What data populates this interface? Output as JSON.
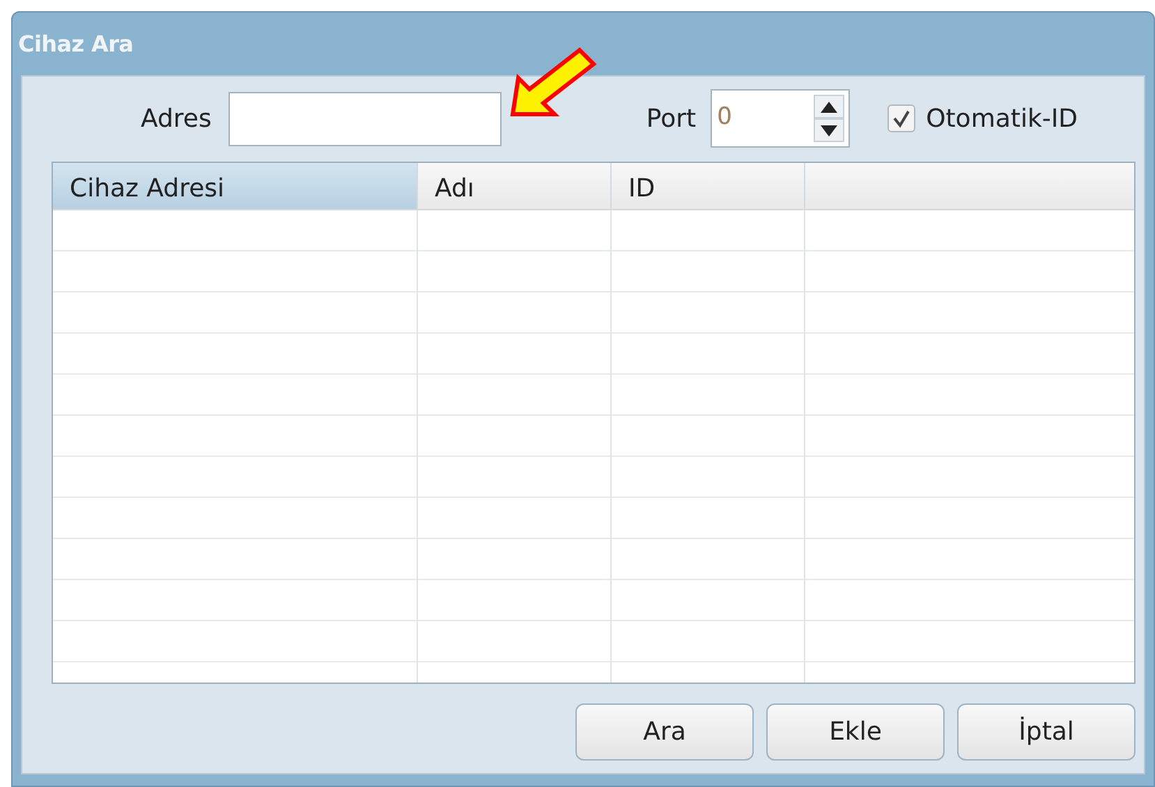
{
  "window": {
    "title": "Cihaz Ara"
  },
  "address": {
    "label": "Adres"
  },
  "port": {
    "label": "Port",
    "value": "0",
    "disabled": true
  },
  "auto_id": {
    "label": "Otomatik-ID",
    "checked": true
  },
  "table": {
    "columns": [
      {
        "label": "Cihaz Adresi",
        "selected": true
      },
      {
        "label": "Adı",
        "selected": false
      },
      {
        "label": "ID",
        "selected": false
      }
    ]
  },
  "annotation": {
    "kind": "arrow"
  },
  "buttons": [
    "Ara",
    "Ekle",
    "İptal"
  ]
}
